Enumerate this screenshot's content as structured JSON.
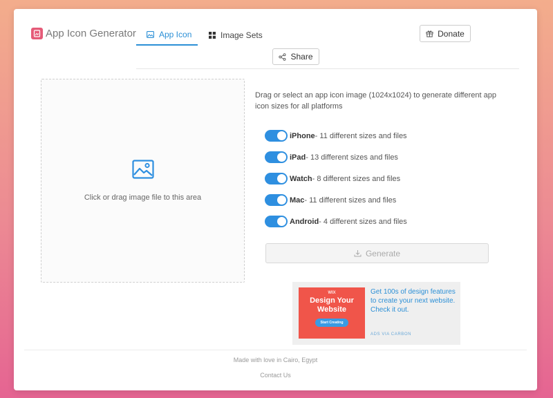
{
  "app": {
    "title": "App Icon Generator"
  },
  "tabs": [
    {
      "label": "App Icon",
      "active": true,
      "icon": "image-icon"
    },
    {
      "label": "Image Sets",
      "active": false,
      "icon": "grid-icon"
    }
  ],
  "header": {
    "donate_label": "Donate",
    "share_label": "Share"
  },
  "dropzone": {
    "text": "Click or drag image file to this area",
    "icon": "image-upload-icon"
  },
  "description": "Drag or select an app icon image (1024x1024) to generate different app icon sizes for all platforms",
  "platforms": [
    {
      "name": "iPhone",
      "detail": " - 11 different sizes and files",
      "enabled": true
    },
    {
      "name": "iPad",
      "detail": " - 13 different sizes and files",
      "enabled": true
    },
    {
      "name": "Watch",
      "detail": " - 8 different sizes and files",
      "enabled": true
    },
    {
      "name": "Mac",
      "detail": " - 11 different sizes and files",
      "enabled": true
    },
    {
      "name": "Android",
      "detail": " - 4 different sizes and files",
      "enabled": true
    }
  ],
  "generate": {
    "label": "Generate",
    "disabled": true
  },
  "ad": {
    "brand": "WIX",
    "headline": "Design Your Website",
    "cta": "Start Creating",
    "copy": "Get 100s of design features to create your next website. Check it out.",
    "via": "ADS VIA CARBON"
  },
  "footer": {
    "made_with": "Made with love in Cairo, Egypt",
    "contact": "Contact Us"
  },
  "colors": {
    "accent": "#2b8fd6",
    "toggle_on": "#2e8fe0",
    "logo": "#e55b78",
    "ad_background": "#f0554a"
  }
}
